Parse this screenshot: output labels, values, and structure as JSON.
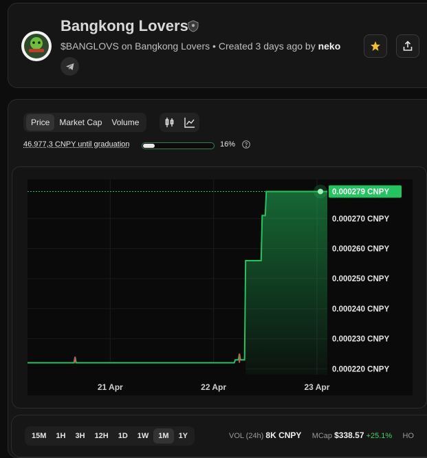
{
  "token": {
    "name": "Bangkong Lovers",
    "ticker_line": "$BANGLOVS on Bangkong Lovers",
    "separator": "•",
    "created": "Created 3 days ago by",
    "creator": "neko"
  },
  "icons": {
    "verified": "shield-badge-icon",
    "telegram": "telegram-icon",
    "favorite": "star-icon",
    "share": "share-icon",
    "candles": "candlestick-icon",
    "line": "line-chart-icon",
    "help": "question-circle-icon"
  },
  "colors": {
    "accent_green": "#22c55e",
    "star": "#f6c21b",
    "positive": "#3cd46a"
  },
  "metric_tabs": [
    "Price",
    "Market Cap",
    "Volume"
  ],
  "metric_selected": "Price",
  "graduation": {
    "text": "46.977,3 CNPY until graduation",
    "progress": 0.16,
    "percent_label": "16%"
  },
  "chart_data": {
    "type": "area",
    "x_tick_labels": [
      "21 Apr",
      "22 Apr",
      "23 Apr"
    ],
    "y_tick_labels": [
      "0.000270 CNPY",
      "0.000260 CNPY",
      "0.000250 CNPY",
      "0.000240 CNPY",
      "0.000230 CNPY",
      "0.000220 CNPY"
    ],
    "y_ticks": [
      0.00027,
      0.00026,
      0.00025,
      0.00024,
      0.00023,
      0.00022
    ],
    "ylim": [
      0.000218,
      0.000283
    ],
    "current_price": 0.000279,
    "current_price_label": "0.000279 CNPY",
    "x_range_days": [
      20.2,
      23.1
    ],
    "series": [
      {
        "points": [
          [
            20.2,
            0.000222
          ],
          [
            20.65,
            0.000222
          ],
          [
            20.66,
            0.000224
          ],
          [
            20.67,
            0.000222
          ],
          [
            22.15,
            0.000222
          ],
          [
            22.2,
            0.000222
          ],
          [
            22.21,
            0.000223
          ],
          [
            22.24,
            0.000223
          ],
          [
            22.25,
            0.000225
          ],
          [
            22.26,
            0.000223
          ],
          [
            22.28,
            0.000223
          ],
          [
            22.3,
            0.000223
          ],
          [
            22.31,
            0.000256
          ],
          [
            22.46,
            0.000256
          ],
          [
            22.47,
            0.000271
          ],
          [
            22.5,
            0.000271
          ],
          [
            22.51,
            0.000279
          ],
          [
            23.1,
            0.000279
          ]
        ]
      }
    ]
  },
  "timeframes": [
    "15M",
    "1H",
    "3H",
    "12H",
    "1D",
    "1W",
    "1M",
    "1Y"
  ],
  "timeframe_selected": "1M",
  "stats": {
    "vol_label": "VOL (24h)",
    "vol_value": "8K CNPY",
    "mcap_label": "MCap",
    "mcap_value": "$338.57",
    "mcap_change": "+25.1%",
    "trailing": "HO"
  }
}
